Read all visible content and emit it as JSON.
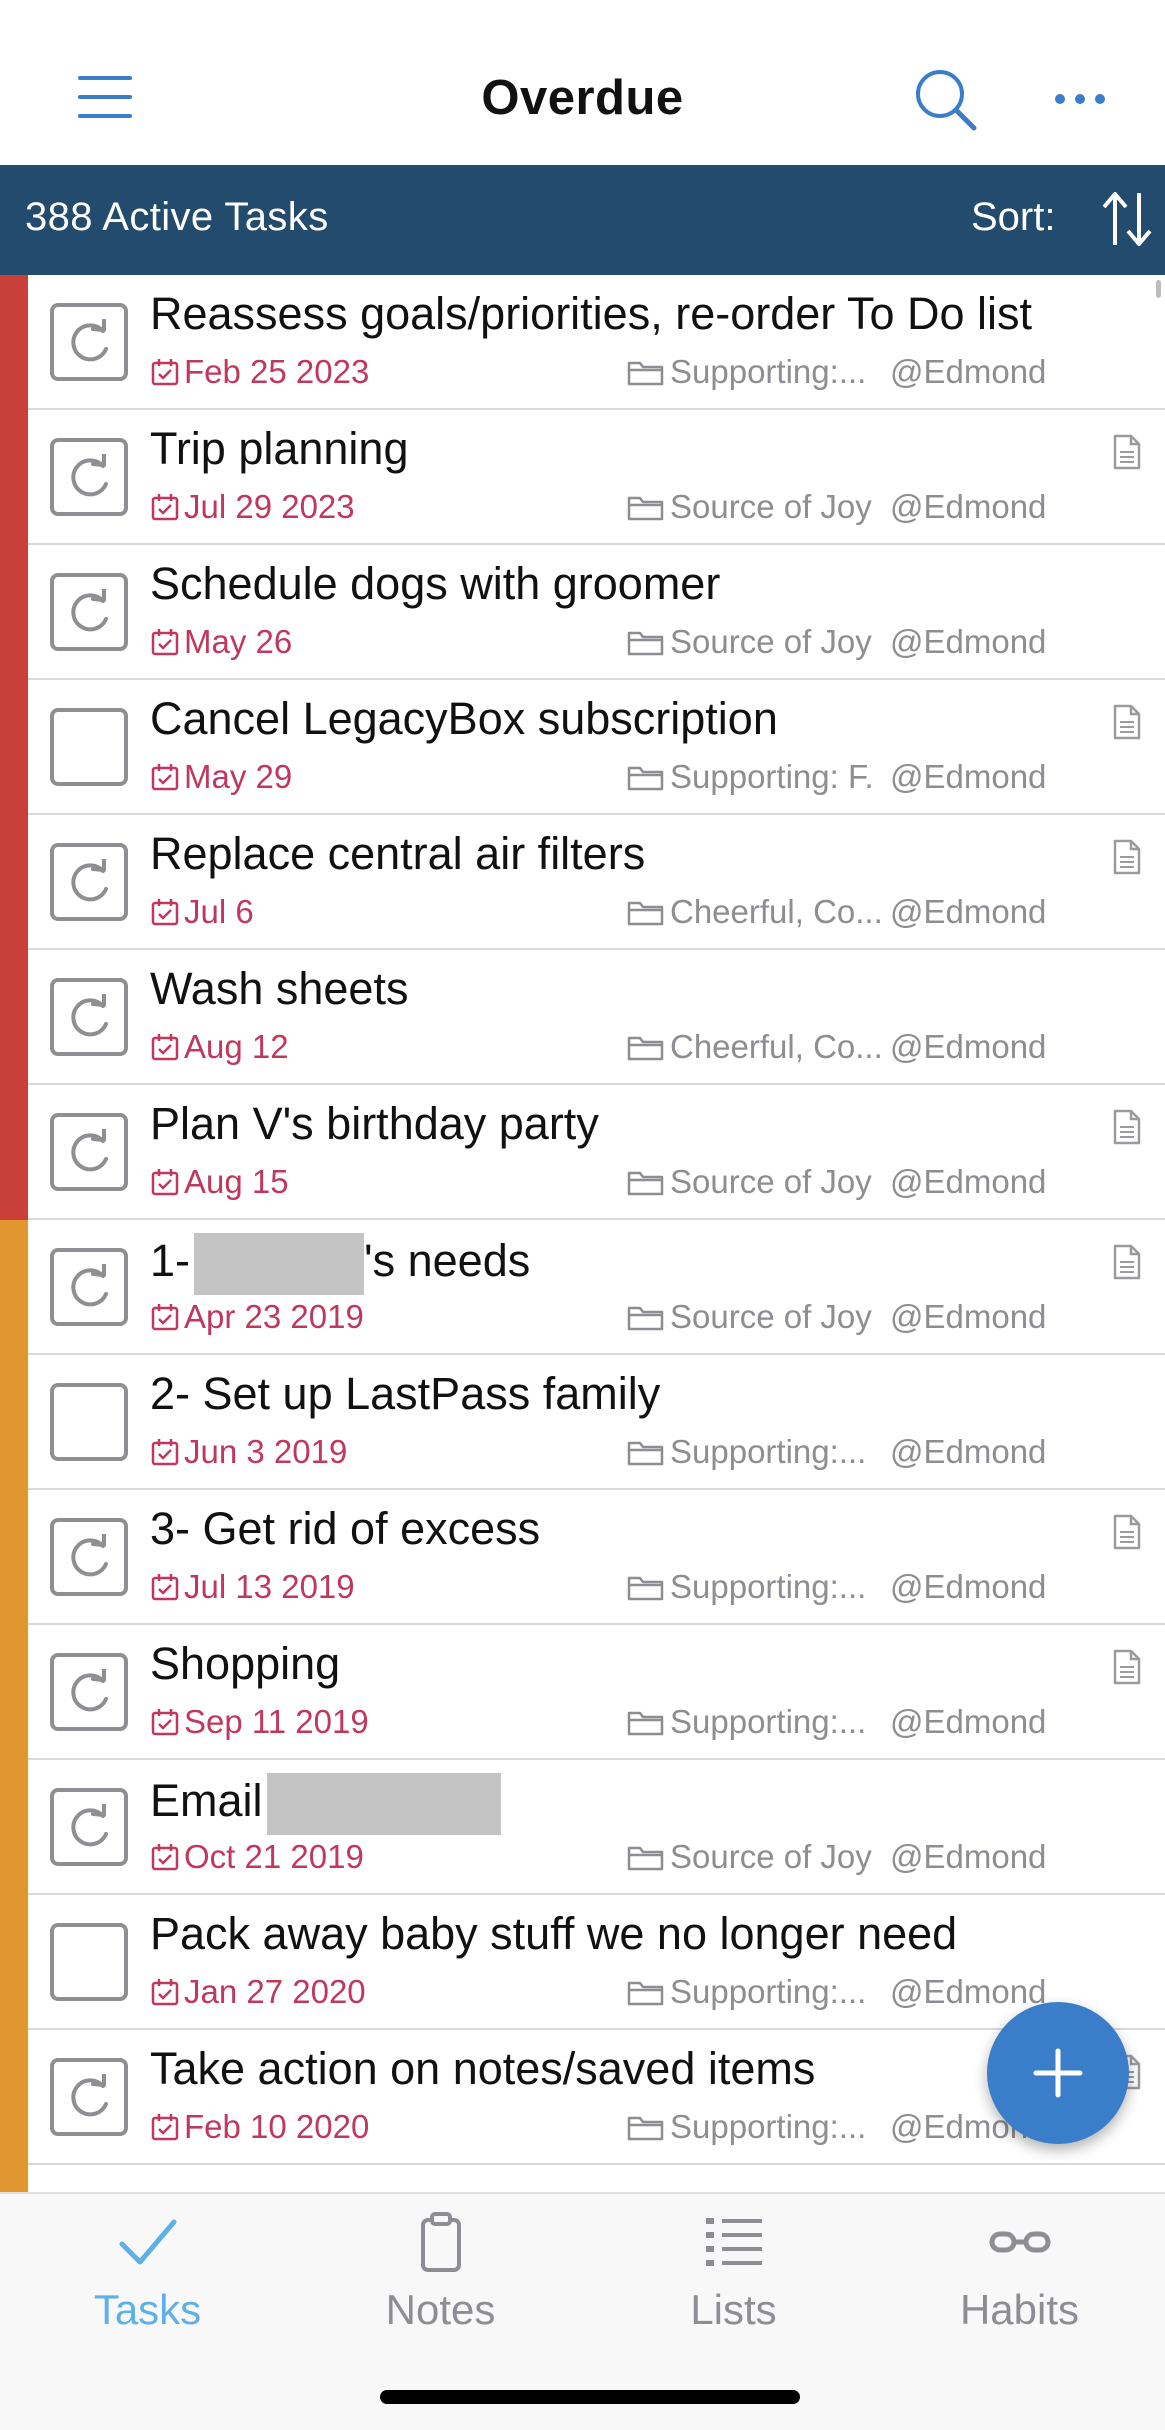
{
  "header": {
    "title": "Overdue"
  },
  "subbar": {
    "count": "388 Active Tasks",
    "sort_label": "Sort:"
  },
  "colors": {
    "accent": "#3a7dc9",
    "banner": "#234b6d",
    "priority_high": "#c9403a",
    "priority_medium": "#e2962f",
    "due": "#c0385e"
  },
  "tasks": [
    {
      "name": "Reassess goals/priorities, re-order To Do list",
      "date": "Feb 25 2023",
      "folder": "Supporting:...",
      "context": "@Edmond",
      "repeat": true,
      "note": false,
      "priority": "high"
    },
    {
      "name": "Trip planning",
      "date": "Jul 29 2023",
      "folder": "Source of Joy",
      "context": "@Edmond",
      "repeat": true,
      "note": true,
      "priority": "high"
    },
    {
      "name": "Schedule dogs with groomer",
      "date": "May 26",
      "folder": "Source of Joy",
      "context": "@Edmond",
      "repeat": true,
      "note": false,
      "priority": "high"
    },
    {
      "name": "Cancel LegacyBox subscription",
      "date": "May 29",
      "folder": "Supporting: F.",
      "context": "@Edmond",
      "repeat": false,
      "note": true,
      "priority": "high"
    },
    {
      "name": "Replace central air filters",
      "date": "Jul 6",
      "folder": "Cheerful, Co...",
      "context": "@Edmond",
      "repeat": true,
      "note": true,
      "priority": "high"
    },
    {
      "name": "Wash sheets",
      "date": "Aug 12",
      "folder": "Cheerful, Co...",
      "context": "@Edmond",
      "repeat": true,
      "note": false,
      "priority": "high"
    },
    {
      "name": "Plan V's birthday party",
      "date": "Aug 15",
      "folder": "Source of Joy",
      "context": "@Edmond",
      "repeat": true,
      "note": true,
      "priority": "high"
    },
    {
      "name": "1-",
      "name_suffix": "'s needs",
      "redact": 170,
      "date": "Apr 23 2019",
      "folder": "Source of Joy",
      "context": "@Edmond",
      "repeat": true,
      "note": true,
      "priority": "medium"
    },
    {
      "name": "2- Set up LastPass family",
      "date": "Jun 3 2019",
      "folder": "Supporting:...",
      "context": "@Edmond",
      "repeat": false,
      "note": false,
      "priority": "medium"
    },
    {
      "name": "3- Get rid of excess",
      "date": "Jul 13 2019",
      "folder": "Supporting:...",
      "context": "@Edmond",
      "repeat": true,
      "note": true,
      "priority": "medium"
    },
    {
      "name": "Shopping",
      "date": "Sep 11 2019",
      "folder": "Supporting:...",
      "context": "@Edmond",
      "repeat": true,
      "note": true,
      "priority": "medium"
    },
    {
      "name": "Email",
      "redact": 234,
      "date": "Oct 21 2019",
      "folder": "Source of Joy",
      "context": "@Edmond",
      "repeat": true,
      "note": false,
      "priority": "medium"
    },
    {
      "name": "Pack away baby stuff we no longer need",
      "date": "Jan 27 2020",
      "folder": "Supporting:...",
      "context": "@Edmond",
      "repeat": false,
      "note": false,
      "priority": "medium"
    },
    {
      "name": "Take action on notes/saved items",
      "date": "Feb 10 2020",
      "folder": "Supporting:...",
      "context": "@Edmond",
      "repeat": true,
      "note": true,
      "priority": "medium"
    },
    {
      "name": "",
      "date": "",
      "folder": "",
      "context": "",
      "repeat": true,
      "note": false,
      "priority": "medium"
    }
  ],
  "tabs": [
    {
      "label": "Tasks",
      "icon": "checkmark-icon",
      "active": true
    },
    {
      "label": "Notes",
      "icon": "clipboard-icon",
      "active": false
    },
    {
      "label": "Lists",
      "icon": "list-icon",
      "active": false
    },
    {
      "label": "Habits",
      "icon": "habits-icon",
      "active": false
    }
  ]
}
